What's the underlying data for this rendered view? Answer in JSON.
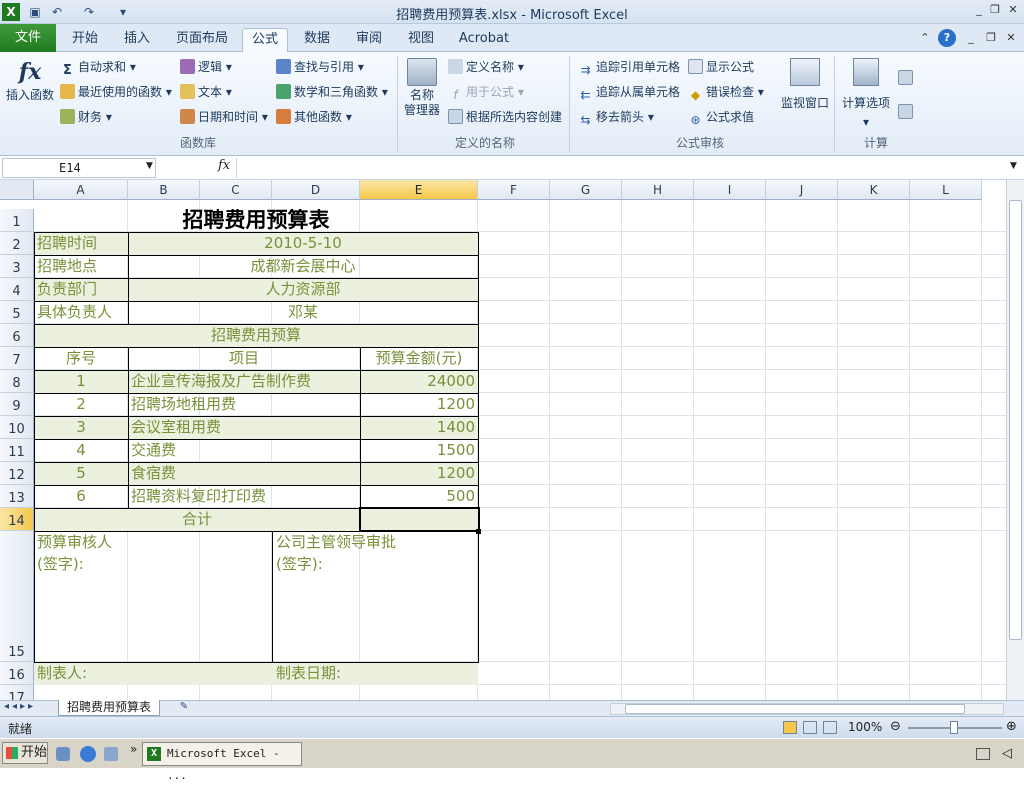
{
  "window": {
    "title": "招聘费用预算表.xlsx  -  Microsoft Excel"
  },
  "tabs": [
    "文件",
    "开始",
    "插入",
    "页面布局",
    "公式",
    "数据",
    "审阅",
    "视图",
    "Acrobat"
  ],
  "ribbon": {
    "insert_function": "插入函数",
    "library": {
      "autosum": "自动求和",
      "recent": "最近使用的函数",
      "financial": "财务",
      "logical": "逻辑",
      "text": "文本",
      "datetime": "日期和时间",
      "lookup": "查找与引用",
      "math": "数学和三角函数",
      "other": "其他函数",
      "group_label": "函数库"
    },
    "names": {
      "name_manager_1": "名称",
      "name_manager_2": "管理器",
      "define": "定义名称",
      "use": "用于公式",
      "create": "根据所选内容创建",
      "group_label": "定义的名称"
    },
    "audit": {
      "trace_prec": "追踪引用单元格",
      "trace_dep": "追踪从属单元格",
      "remove": "移去箭头",
      "show": "显示公式",
      "check": "错误检查",
      "evaluate": "公式求值",
      "watch": "监视窗口",
      "group_label": "公式审核"
    },
    "calc": {
      "options": "计算选项",
      "group_label": "计算"
    }
  },
  "formula_bar": {
    "name_box": "E14",
    "fx": "fx",
    "value": ""
  },
  "columns": [
    "A",
    "B",
    "C",
    "D",
    "E",
    "F",
    "G",
    "H",
    "I",
    "J",
    "K",
    "L"
  ],
  "rows": [
    "1",
    "2",
    "3",
    "4",
    "5",
    "6",
    "7",
    "8",
    "9",
    "10",
    "11",
    "12",
    "13",
    "14",
    "15",
    "16",
    "17"
  ],
  "sheet": {
    "title": "招聘费用预算表",
    "info": [
      {
        "label": "招聘时间",
        "value": "2010-5-10"
      },
      {
        "label": "招聘地点",
        "value": "成都新会展中心"
      },
      {
        "label": "负责部门",
        "value": "人力资源部"
      },
      {
        "label": "具体负责人",
        "value": "邓某"
      }
    ],
    "section_title": "招聘费用预算",
    "headers": {
      "no": "序号",
      "item": "项目",
      "amount": "预算金额(元)"
    },
    "items": [
      {
        "no": "1",
        "item": "企业宣传海报及广告制作费",
        "amount": "24000"
      },
      {
        "no": "2",
        "item": "招聘场地租用费",
        "amount": "1200"
      },
      {
        "no": "3",
        "item": "会议室租用费",
        "amount": "1400"
      },
      {
        "no": "4",
        "item": "交通费",
        "amount": "1500"
      },
      {
        "no": "5",
        "item": "食宿费",
        "amount": "1200"
      },
      {
        "no": "6",
        "item": "招聘资料复印打印费",
        "amount": "500"
      }
    ],
    "total_label": "合计",
    "reviewer": "预算审核人",
    "reviewer_sign": "(签字):",
    "approver": "公司主管领导审批",
    "approver_sign": "(签字):",
    "maker": "制表人:",
    "make_date": "制表日期:"
  },
  "sheet_tab": "招聘费用预算表",
  "status": {
    "ready": "就绪",
    "zoom": "100%"
  },
  "taskbar": {
    "start": "开始",
    "app": "Microsoft Excel - ..."
  }
}
